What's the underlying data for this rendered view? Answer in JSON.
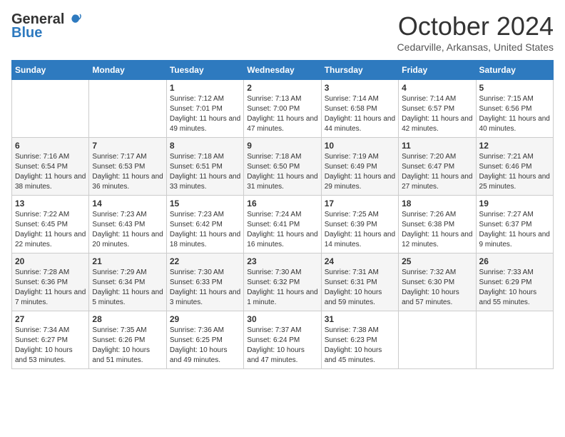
{
  "logo": {
    "general": "General",
    "blue": "Blue"
  },
  "title": "October 2024",
  "location": "Cedarville, Arkansas, United States",
  "days_of_week": [
    "Sunday",
    "Monday",
    "Tuesday",
    "Wednesday",
    "Thursday",
    "Friday",
    "Saturday"
  ],
  "weeks": [
    [
      {
        "num": "",
        "sunrise": "",
        "sunset": "",
        "daylight": ""
      },
      {
        "num": "",
        "sunrise": "",
        "sunset": "",
        "daylight": ""
      },
      {
        "num": "1",
        "sunrise": "Sunrise: 7:12 AM",
        "sunset": "Sunset: 7:01 PM",
        "daylight": "Daylight: 11 hours and 49 minutes."
      },
      {
        "num": "2",
        "sunrise": "Sunrise: 7:13 AM",
        "sunset": "Sunset: 7:00 PM",
        "daylight": "Daylight: 11 hours and 47 minutes."
      },
      {
        "num": "3",
        "sunrise": "Sunrise: 7:14 AM",
        "sunset": "Sunset: 6:58 PM",
        "daylight": "Daylight: 11 hours and 44 minutes."
      },
      {
        "num": "4",
        "sunrise": "Sunrise: 7:14 AM",
        "sunset": "Sunset: 6:57 PM",
        "daylight": "Daylight: 11 hours and 42 minutes."
      },
      {
        "num": "5",
        "sunrise": "Sunrise: 7:15 AM",
        "sunset": "Sunset: 6:56 PM",
        "daylight": "Daylight: 11 hours and 40 minutes."
      }
    ],
    [
      {
        "num": "6",
        "sunrise": "Sunrise: 7:16 AM",
        "sunset": "Sunset: 6:54 PM",
        "daylight": "Daylight: 11 hours and 38 minutes."
      },
      {
        "num": "7",
        "sunrise": "Sunrise: 7:17 AM",
        "sunset": "Sunset: 6:53 PM",
        "daylight": "Daylight: 11 hours and 36 minutes."
      },
      {
        "num": "8",
        "sunrise": "Sunrise: 7:18 AM",
        "sunset": "Sunset: 6:51 PM",
        "daylight": "Daylight: 11 hours and 33 minutes."
      },
      {
        "num": "9",
        "sunrise": "Sunrise: 7:18 AM",
        "sunset": "Sunset: 6:50 PM",
        "daylight": "Daylight: 11 hours and 31 minutes."
      },
      {
        "num": "10",
        "sunrise": "Sunrise: 7:19 AM",
        "sunset": "Sunset: 6:49 PM",
        "daylight": "Daylight: 11 hours and 29 minutes."
      },
      {
        "num": "11",
        "sunrise": "Sunrise: 7:20 AM",
        "sunset": "Sunset: 6:47 PM",
        "daylight": "Daylight: 11 hours and 27 minutes."
      },
      {
        "num": "12",
        "sunrise": "Sunrise: 7:21 AM",
        "sunset": "Sunset: 6:46 PM",
        "daylight": "Daylight: 11 hours and 25 minutes."
      }
    ],
    [
      {
        "num": "13",
        "sunrise": "Sunrise: 7:22 AM",
        "sunset": "Sunset: 6:45 PM",
        "daylight": "Daylight: 11 hours and 22 minutes."
      },
      {
        "num": "14",
        "sunrise": "Sunrise: 7:23 AM",
        "sunset": "Sunset: 6:43 PM",
        "daylight": "Daylight: 11 hours and 20 minutes."
      },
      {
        "num": "15",
        "sunrise": "Sunrise: 7:23 AM",
        "sunset": "Sunset: 6:42 PM",
        "daylight": "Daylight: 11 hours and 18 minutes."
      },
      {
        "num": "16",
        "sunrise": "Sunrise: 7:24 AM",
        "sunset": "Sunset: 6:41 PM",
        "daylight": "Daylight: 11 hours and 16 minutes."
      },
      {
        "num": "17",
        "sunrise": "Sunrise: 7:25 AM",
        "sunset": "Sunset: 6:39 PM",
        "daylight": "Daylight: 11 hours and 14 minutes."
      },
      {
        "num": "18",
        "sunrise": "Sunrise: 7:26 AM",
        "sunset": "Sunset: 6:38 PM",
        "daylight": "Daylight: 11 hours and 12 minutes."
      },
      {
        "num": "19",
        "sunrise": "Sunrise: 7:27 AM",
        "sunset": "Sunset: 6:37 PM",
        "daylight": "Daylight: 11 hours and 9 minutes."
      }
    ],
    [
      {
        "num": "20",
        "sunrise": "Sunrise: 7:28 AM",
        "sunset": "Sunset: 6:36 PM",
        "daylight": "Daylight: 11 hours and 7 minutes."
      },
      {
        "num": "21",
        "sunrise": "Sunrise: 7:29 AM",
        "sunset": "Sunset: 6:34 PM",
        "daylight": "Daylight: 11 hours and 5 minutes."
      },
      {
        "num": "22",
        "sunrise": "Sunrise: 7:30 AM",
        "sunset": "Sunset: 6:33 PM",
        "daylight": "Daylight: 11 hours and 3 minutes."
      },
      {
        "num": "23",
        "sunrise": "Sunrise: 7:30 AM",
        "sunset": "Sunset: 6:32 PM",
        "daylight": "Daylight: 11 hours and 1 minute."
      },
      {
        "num": "24",
        "sunrise": "Sunrise: 7:31 AM",
        "sunset": "Sunset: 6:31 PM",
        "daylight": "Daylight: 10 hours and 59 minutes."
      },
      {
        "num": "25",
        "sunrise": "Sunrise: 7:32 AM",
        "sunset": "Sunset: 6:30 PM",
        "daylight": "Daylight: 10 hours and 57 minutes."
      },
      {
        "num": "26",
        "sunrise": "Sunrise: 7:33 AM",
        "sunset": "Sunset: 6:29 PM",
        "daylight": "Daylight: 10 hours and 55 minutes."
      }
    ],
    [
      {
        "num": "27",
        "sunrise": "Sunrise: 7:34 AM",
        "sunset": "Sunset: 6:27 PM",
        "daylight": "Daylight: 10 hours and 53 minutes."
      },
      {
        "num": "28",
        "sunrise": "Sunrise: 7:35 AM",
        "sunset": "Sunset: 6:26 PM",
        "daylight": "Daylight: 10 hours and 51 minutes."
      },
      {
        "num": "29",
        "sunrise": "Sunrise: 7:36 AM",
        "sunset": "Sunset: 6:25 PM",
        "daylight": "Daylight: 10 hours and 49 minutes."
      },
      {
        "num": "30",
        "sunrise": "Sunrise: 7:37 AM",
        "sunset": "Sunset: 6:24 PM",
        "daylight": "Daylight: 10 hours and 47 minutes."
      },
      {
        "num": "31",
        "sunrise": "Sunrise: 7:38 AM",
        "sunset": "Sunset: 6:23 PM",
        "daylight": "Daylight: 10 hours and 45 minutes."
      },
      {
        "num": "",
        "sunrise": "",
        "sunset": "",
        "daylight": ""
      },
      {
        "num": "",
        "sunrise": "",
        "sunset": "",
        "daylight": ""
      }
    ]
  ]
}
